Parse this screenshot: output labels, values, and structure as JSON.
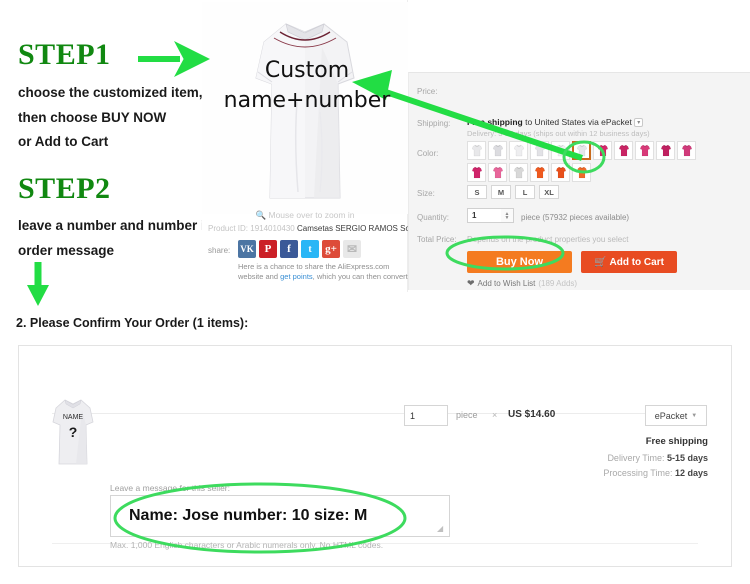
{
  "steps": [
    {
      "title": "STEP1",
      "lines": [
        "choose the customized item,",
        "then choose BUY NOW",
        "or Add to Cart"
      ],
      "arrow": "right-arrow-icon"
    },
    {
      "title": "STEP2",
      "lines": [
        "leave a number and number in",
        "order message"
      ],
      "arrow": "down-arrow-icon"
    }
  ],
  "annotations": {
    "custom_caption_line1": "Custom",
    "custom_caption_line2": "name+number",
    "accent_green": "#22dd44",
    "highlight_orange": "#c96a1b"
  },
  "gallery": {
    "zoom_hint": "Mouse over to zoom in",
    "product_id_label": "Product ID:",
    "product_id_value": "1914010430",
    "product_title": "Camsetas SERGIO RAMOS Soccer ...",
    "share_label": "share:",
    "share_icons": [
      {
        "name": "vk-icon",
        "glyph": "VK"
      },
      {
        "name": "pinterest-icon",
        "glyph": "P"
      },
      {
        "name": "facebook-icon",
        "glyph": "f"
      },
      {
        "name": "twitter-icon",
        "glyph": "t"
      },
      {
        "name": "googleplus-icon",
        "glyph": "g+"
      },
      {
        "name": "email-icon",
        "glyph": "✉"
      }
    ],
    "share_note_part1": "Here is a chance to share the AliExpress.com website and ",
    "share_note_link": "get points",
    "share_note_part2": ", which you can then convert"
  },
  "detail": {
    "price_label": "Price:",
    "price_value": "",
    "shipping_label": "Shipping:",
    "shipping_free": "Free shipping",
    "shipping_rest": " to United States via ePacket",
    "shipping_delivery": "Delivery: 5-15 days (ships out within 12 business days)",
    "color_label": "Color:",
    "color_swatches_row1": [
      {
        "name": "swatch-white-1",
        "color": "#e8e8ea",
        "selected": false
      },
      {
        "name": "swatch-white-2",
        "color": "#dcdce0",
        "selected": false
      },
      {
        "name": "swatch-white-3",
        "color": "#eeeef0",
        "selected": false
      },
      {
        "name": "swatch-white-4",
        "color": "#e2e2e6",
        "selected": false
      },
      {
        "name": "swatch-white-5",
        "color": "#f0f0f2",
        "selected": false
      },
      {
        "name": "swatch-white-6-selected",
        "color": "#e6e6ea",
        "selected": true
      },
      {
        "name": "swatch-pink-1",
        "color": "#d6276b",
        "selected": false
      },
      {
        "name": "swatch-pink-2",
        "color": "#c92464",
        "selected": false
      },
      {
        "name": "swatch-pink-3",
        "color": "#d83a78",
        "selected": false
      },
      {
        "name": "swatch-pink-4",
        "color": "#c02060",
        "selected": false
      },
      {
        "name": "swatch-pink-5",
        "color": "#d13a7a",
        "selected": false
      }
    ],
    "color_swatches_row2": [
      {
        "name": "swatch-magenta-1",
        "color": "#d0246a",
        "selected": false
      },
      {
        "name": "swatch-rose-1",
        "color": "#e8659a",
        "selected": false
      },
      {
        "name": "swatch-grey-lock",
        "color": "#d8d8d8",
        "selected": false
      },
      {
        "name": "swatch-orange-1",
        "color": "#ef5a20",
        "selected": false
      },
      {
        "name": "swatch-orange-2",
        "color": "#e8501c",
        "selected": false
      },
      {
        "name": "swatch-orange-3",
        "color": "#f06a28",
        "selected": false
      }
    ],
    "size_label": "Size:",
    "sizes": [
      "S",
      "M",
      "L",
      "XL"
    ],
    "quantity_label": "Quantity:",
    "quantity_value": "1",
    "quantity_note": "piece (57932 pieces available)",
    "total_price_label": "Total Price:",
    "total_price_value": "Depends on the product properties you select",
    "buy_now_label": "Buy Now",
    "add_to_cart_label": "Add to Cart",
    "cart_icon": "cart-icon",
    "wishlist_label": "Add to Wish List",
    "wishlist_count": "(189 Adds)",
    "wishlist_icon": "heart-icon"
  },
  "order": {
    "section_title": "2. Please Confirm Your Order (1 items):",
    "thumb_name_text": "NAME",
    "thumb_number_text": "?",
    "quantity_value": "1",
    "piece_label": "piece",
    "multiply_symbol": "×",
    "unit_price": "US $14.60",
    "shipping_method": "ePacket",
    "shipping_caret": "chevron-down-icon",
    "free_shipping": "Free shipping",
    "delivery_time_label": "Delivery Time:",
    "delivery_time_value": "5-15 days",
    "processing_time_label": "Processing Time:",
    "processing_time_value": "12 days",
    "message_label": "Leave a message for this seller:",
    "message_value": "Name: Jose number: 10 size: M",
    "message_hint": "Max. 1,000 English characters or Arabic numerals only. No HTML codes."
  }
}
